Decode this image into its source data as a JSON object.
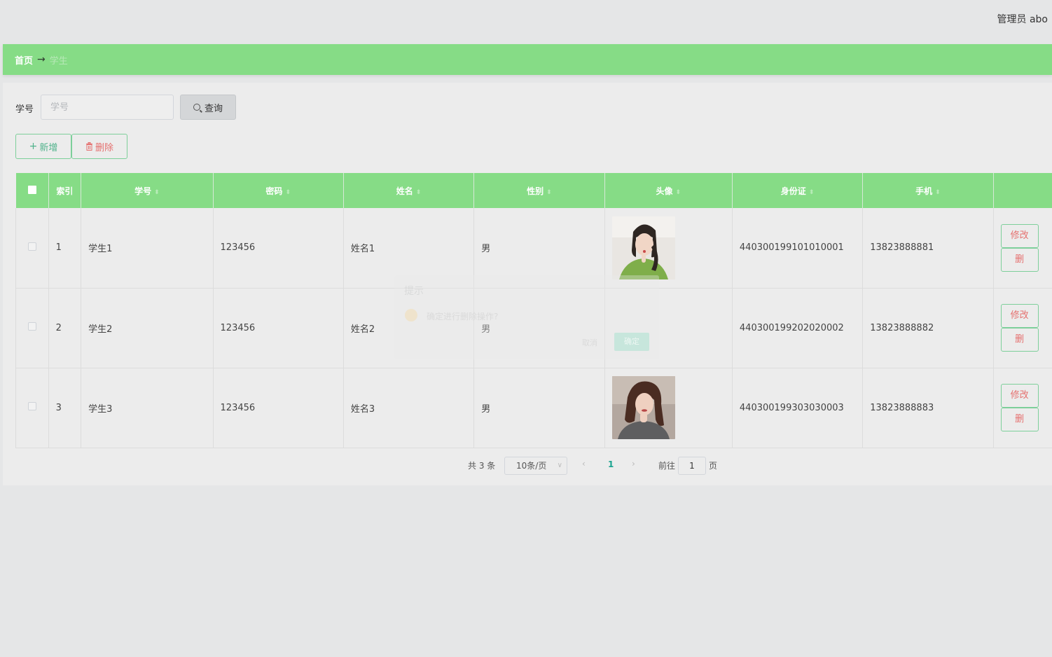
{
  "header": {
    "user_label": "管理员 abo"
  },
  "breadcrumb": {
    "home": "首页",
    "arrow": "→",
    "current": "学生"
  },
  "search": {
    "label": "学号",
    "placeholder": "学号",
    "button_label": "查询"
  },
  "toolbar": {
    "add_label": "新增",
    "delete_label": "删除"
  },
  "table": {
    "columns": [
      "索引",
      "学号",
      "密码",
      "姓名",
      "性别",
      "头像",
      "身份证",
      "手机"
    ],
    "rows": [
      {
        "index": "1",
        "student_no": "学生1",
        "password": "123456",
        "name": "姓名1",
        "gender": "男",
        "avatar": "photo-girl-green-sweater",
        "id_card": "440300199101010001",
        "phone": "13823888881"
      },
      {
        "index": "2",
        "student_no": "学生2",
        "password": "123456",
        "name": "姓名2",
        "gender": "男",
        "avatar": "",
        "id_card": "440300199202020002",
        "phone": "13823888882"
      },
      {
        "index": "3",
        "student_no": "学生3",
        "password": "123456",
        "name": "姓名3",
        "gender": "男",
        "avatar": "photo-girl-gray-top",
        "id_card": "440300199303030003",
        "phone": "13823888883"
      }
    ],
    "edit_label": "修改",
    "delete_label": "删"
  },
  "dialog": {
    "title": "提示",
    "message": "确定进行删除操作?",
    "cancel_label": "取消",
    "confirm_label": "确定"
  },
  "pagination": {
    "total_text": "共 3 条",
    "page_size": "10条/页",
    "current_page": "1",
    "goto_label": "前往",
    "goto_value": "1",
    "page_suffix": "页"
  },
  "colors": {
    "accent_green": "#86dc86",
    "danger_red": "#e5706f",
    "border_green": "#7dcf9a",
    "page_active": "#1aa38f"
  }
}
